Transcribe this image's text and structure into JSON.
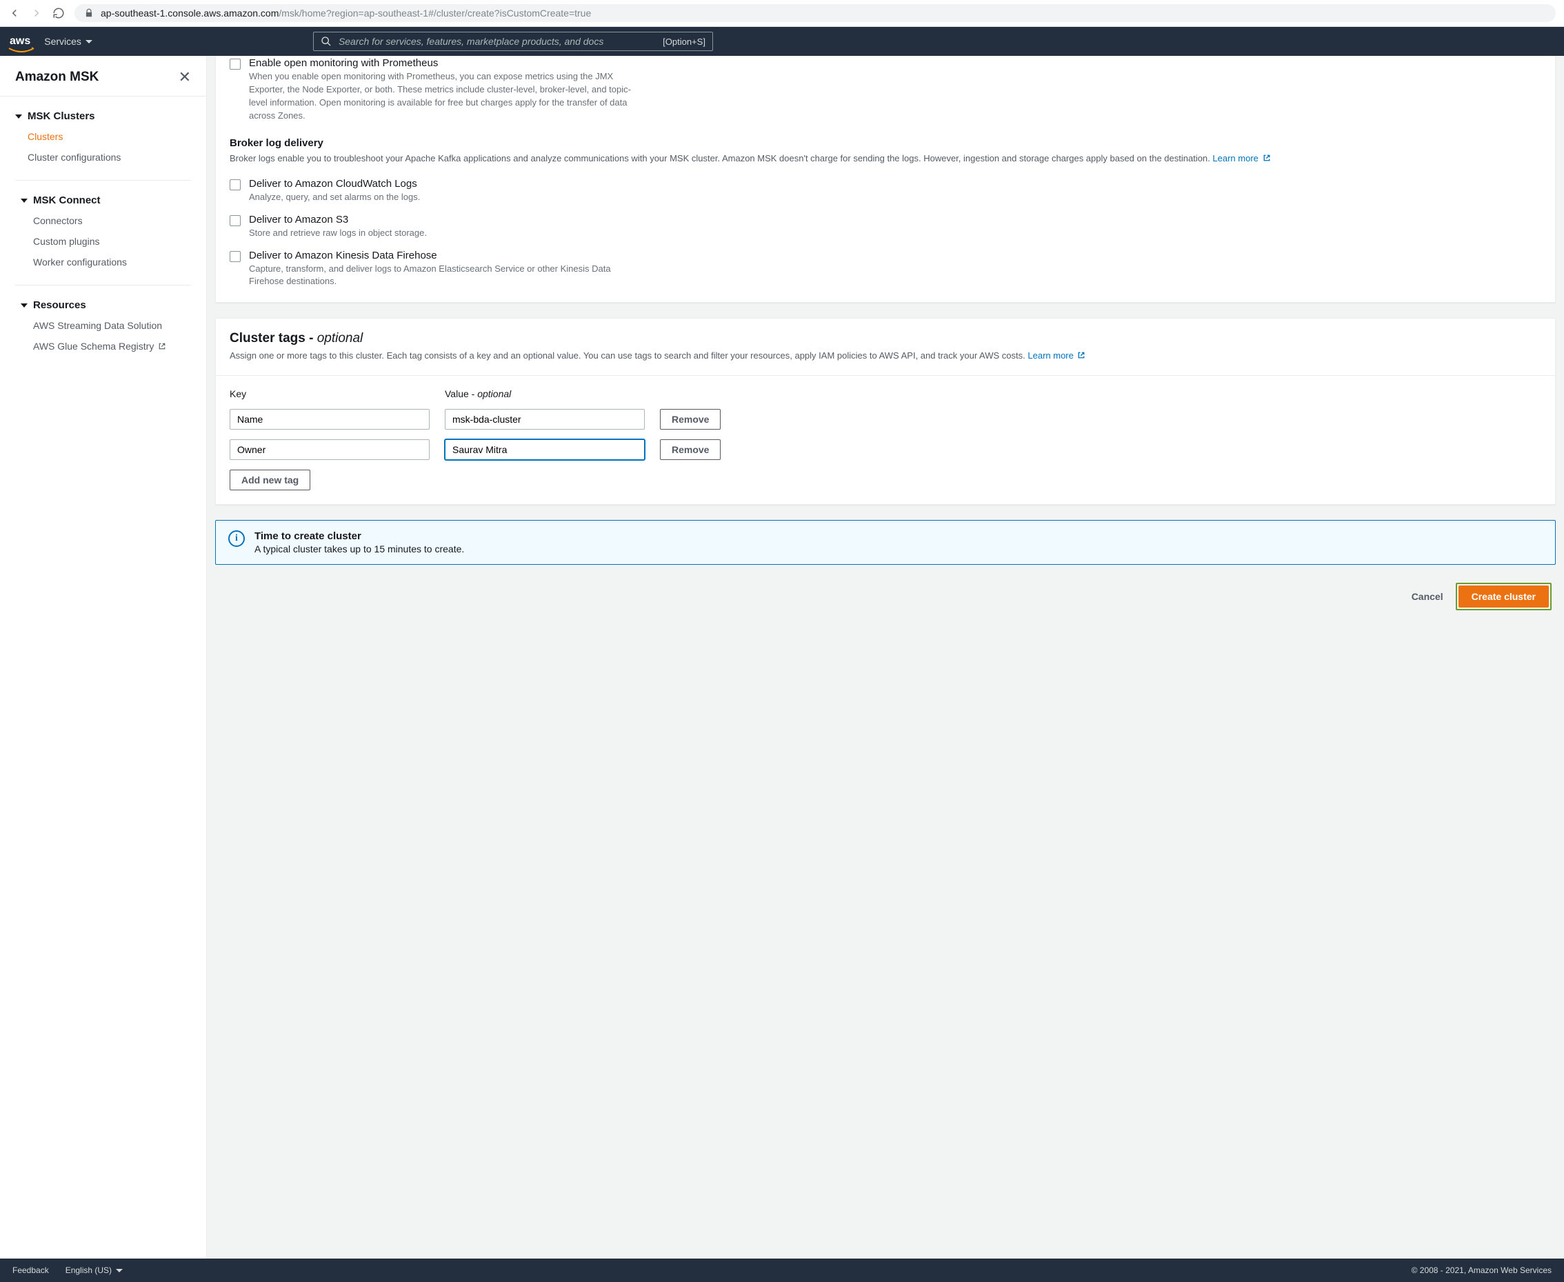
{
  "browser": {
    "url_host": "ap-southeast-1.console.aws.amazon.com",
    "url_path": "/msk/home?region=ap-southeast-1#/cluster/create?isCustomCreate=true"
  },
  "topnav": {
    "logo": "aws",
    "services": "Services",
    "search_placeholder": "Search for services, features, marketplace products, and docs",
    "shortcut": "[Option+S]"
  },
  "sidebar": {
    "title": "Amazon MSK",
    "groups": [
      {
        "heading": "MSK Clusters",
        "items": [
          {
            "label": "Clusters",
            "active": true
          },
          {
            "label": "Cluster configurations"
          }
        ]
      },
      {
        "heading": "MSK Connect",
        "items": [
          {
            "label": "Connectors"
          },
          {
            "label": "Custom plugins"
          },
          {
            "label": "Worker configurations"
          }
        ]
      },
      {
        "heading": "Resources",
        "items": [
          {
            "label": "AWS Streaming Data Solution"
          },
          {
            "label": "AWS Glue Schema Registry",
            "external": true
          }
        ]
      }
    ]
  },
  "monitoring": {
    "prometheus_label": "Enable open monitoring with Prometheus",
    "prometheus_desc": "When you enable open monitoring with Prometheus, you can expose metrics using the JMX Exporter, the Node Exporter, or both. These metrics include cluster-level, broker-level, and topic-level information. Open monitoring is available for free but charges apply for the transfer of data across Zones.",
    "broker_heading": "Broker log delivery",
    "broker_desc": "Broker logs enable you to troubleshoot your Apache Kafka applications and analyze communications with your MSK cluster. Amazon MSK doesn't charge for sending the logs. However, ingestion and storage charges apply based on the destination.",
    "learn_more": "Learn more",
    "deliveries": [
      {
        "label": "Deliver to Amazon CloudWatch Logs",
        "desc": "Analyze, query, and set alarms on the logs."
      },
      {
        "label": "Deliver to Amazon S3",
        "desc": "Store and retrieve raw logs in object storage."
      },
      {
        "label": "Deliver to Amazon Kinesis Data Firehose",
        "desc": "Capture, transform, and deliver logs to Amazon Elasticsearch Service or other Kinesis Data Firehose destinations."
      }
    ]
  },
  "tags": {
    "title": "Cluster tags - ",
    "title_opt": "optional",
    "desc": "Assign one or more tags to this cluster. Each tag consists of a key and an optional value. You can use tags to search and filter your resources, apply IAM policies to AWS API, and track your AWS costs.",
    "learn_more": "Learn more",
    "key_label": "Key",
    "value_label": "Value - ",
    "value_opt": "optional",
    "rows": [
      {
        "key": "Name",
        "value": "msk-bda-cluster",
        "focused": false
      },
      {
        "key": "Owner",
        "value": "Saurav Mitra",
        "focused": true
      }
    ],
    "remove": "Remove",
    "add": "Add new tag"
  },
  "info": {
    "title": "Time to create cluster",
    "desc": "A typical cluster takes up to 15 minutes to create."
  },
  "actions": {
    "cancel": "Cancel",
    "create": "Create cluster"
  },
  "footer": {
    "feedback": "Feedback",
    "language": "English (US)",
    "copyright": "© 2008 - 2021, Amazon Web Services"
  }
}
